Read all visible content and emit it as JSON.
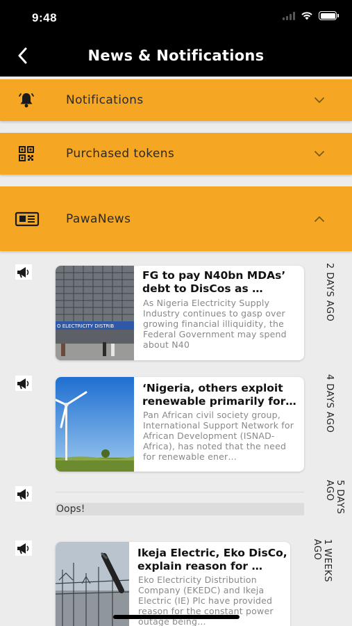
{
  "status_bar": {
    "time": "9:48"
  },
  "nav": {
    "title": "News & Notifications"
  },
  "sections": [
    {
      "label": "Notifications",
      "icon": "bell-icon",
      "expanded": false
    },
    {
      "label": "Purchased tokens",
      "icon": "qr-code-icon",
      "expanded": false
    },
    {
      "label": "PawaNews",
      "icon": "newspaper-icon",
      "expanded": true
    }
  ],
  "news": [
    {
      "title": "FG to pay N40bn MDAs’ debt to DisCos as …",
      "excerpt": "As Nigeria Electricity Supply Industry continues to gasp over growing financial illiquidity, the Federal Government may spend about N40",
      "date": "2 DAYS AGO",
      "thumb_caption": "O ELECTRICITY DISTRIB"
    },
    {
      "title": "‘Nigeria, others exploit renewable primarily for…",
      "excerpt": "Pan African civil society group, International Support Network for African Development (ISNAD-Africa), has noted that the need for renewable ener…",
      "date": "4 DAYS AGO"
    },
    {
      "title": "",
      "excerpt": "Oops!",
      "date": "5 DAYS AGO"
    },
    {
      "title": "Ikeja Electric, Eko DisCo, explain reason for …",
      "excerpt": "Eko Electricity Distribution Company (EKEDC) and Ikeja Electric (IE) Plc have provided reason for the constant power outage being…",
      "date": "1 WEEKS AGO"
    }
  ],
  "colors": {
    "accent": "#f5a623",
    "nav_bg": "#000000",
    "background": "#ececec"
  }
}
